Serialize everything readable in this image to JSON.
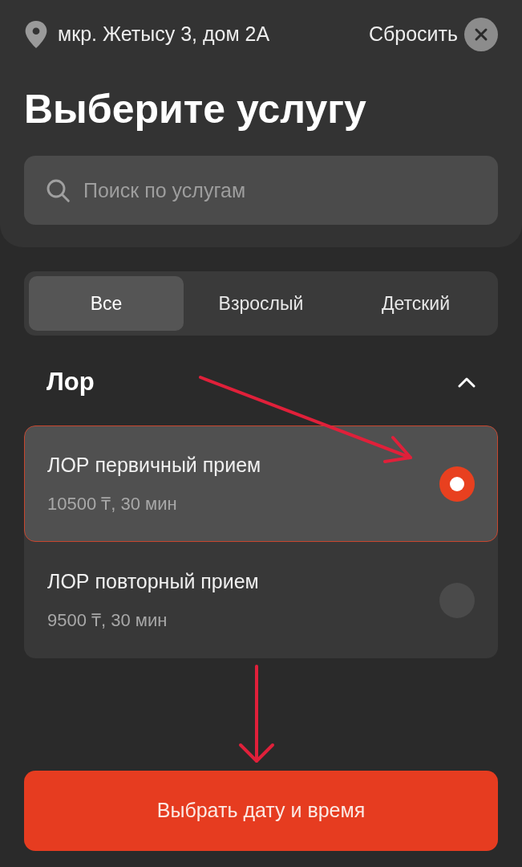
{
  "header": {
    "address": "мкр. Жетысу 3, дом 2А",
    "reset_label": "Сбросить"
  },
  "title": "Выберите услугу",
  "search": {
    "placeholder": "Поиск по услугам"
  },
  "tabs": [
    {
      "label": "Все",
      "selected": true
    },
    {
      "label": "Взрослый",
      "selected": false
    },
    {
      "label": "Детский",
      "selected": false
    }
  ],
  "section": {
    "title": "Лор",
    "expanded": true,
    "services": [
      {
        "name": "ЛОР первичный прием",
        "details": "10500 ₸, 30 мин",
        "selected": true
      },
      {
        "name": "ЛОР повторный прием",
        "details": "9500 ₸, 30 мин",
        "selected": false
      }
    ]
  },
  "primary_button": "Выбрать дату и время"
}
